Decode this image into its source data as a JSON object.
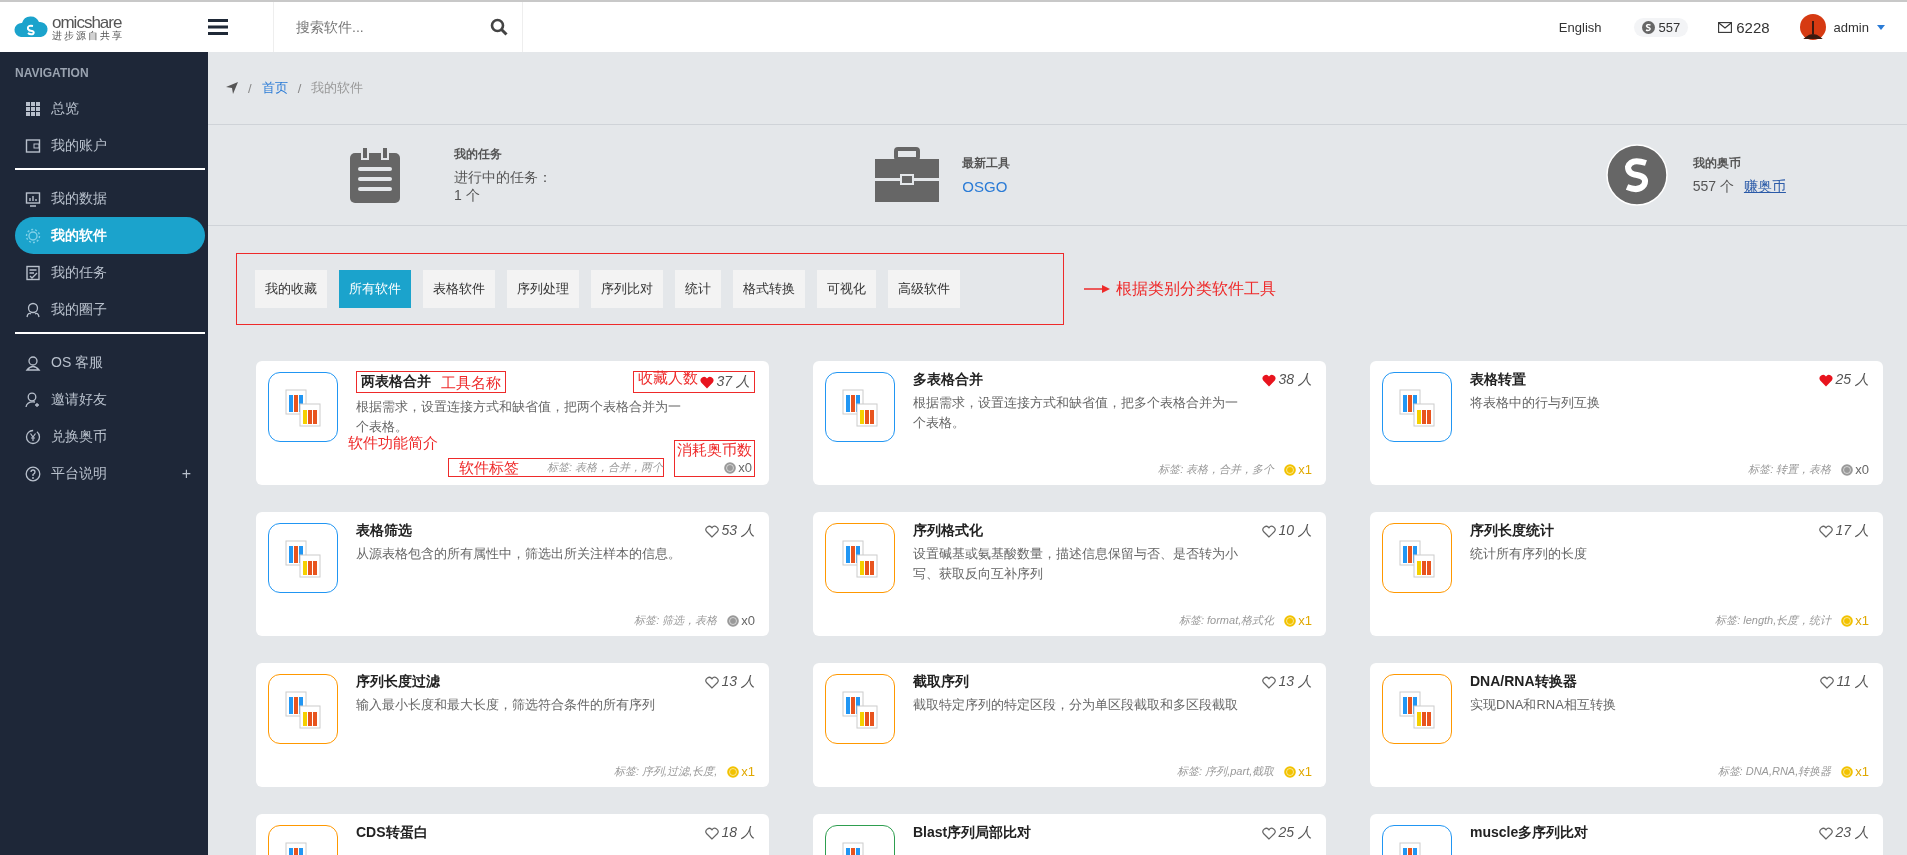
{
  "topbar": {
    "brand": {
      "name": "omicshare",
      "tagline": "进步源自共享"
    },
    "search": {
      "placeholder": "搜索软件..."
    },
    "language": "English",
    "coins": "557",
    "messages": "6228",
    "user": "admin"
  },
  "sidebar": {
    "heading": "NAVIGATION",
    "groups": [
      [
        {
          "label": "总览",
          "selected": false
        },
        {
          "label": "我的账户",
          "selected": false
        }
      ],
      [
        {
          "label": "我的数据",
          "selected": false
        },
        {
          "label": "我的软件",
          "selected": true
        },
        {
          "label": "我的任务",
          "selected": false
        },
        {
          "label": "我的圈子",
          "selected": false
        }
      ],
      [
        {
          "label": "OS 客服",
          "selected": false
        },
        {
          "label": "邀请好友",
          "selected": false
        },
        {
          "label": "兑换奥币",
          "selected": false
        },
        {
          "label": "平台说明",
          "selected": false,
          "expander": "+"
        }
      ]
    ]
  },
  "breadcrumb": {
    "separator": "/",
    "home": "首页",
    "current": "我的软件"
  },
  "stats": [
    {
      "title": "我的任务",
      "lines": [
        "进行中的任务：1 个"
      ]
    },
    {
      "title": "最新工具",
      "link": "OSGO"
    },
    {
      "title": "我的奥币",
      "lines": [
        "557 个"
      ],
      "link": "赚奥币"
    }
  ],
  "tabs": {
    "note": "根据类别分类软件工具",
    "items": [
      {
        "label": "我的收藏",
        "selected": false
      },
      {
        "label": "所有软件",
        "selected": true
      },
      {
        "label": "表格软件",
        "selected": false
      },
      {
        "label": "序列处理",
        "selected": false
      },
      {
        "label": "序列比对",
        "selected": false
      },
      {
        "label": "统计",
        "selected": false
      },
      {
        "label": "格式转换",
        "selected": false
      },
      {
        "label": "可视化",
        "selected": false
      },
      {
        "label": "高级软件",
        "selected": false
      }
    ]
  },
  "tools": [
    {
      "title": "两表格合并",
      "favorited": true,
      "favorites": "37 人",
      "description": "根据需求，设置连接方式和缺省值，把两个表格合并为一个表格。",
      "tags": "标签: 表格，合并，两个",
      "cost": "x0",
      "free": true,
      "color": "#2196f3",
      "notes": {
        "title": "工具名称",
        "favorites": "收藏人数",
        "description": "软件功能简介",
        "tags": "软件标签",
        "cost": "消耗奥币数"
      }
    },
    {
      "title": "多表格合并",
      "favorited": true,
      "favorites": "38 人",
      "description": "根据需求，设置连接方式和缺省值，把多个表格合并为一个表格。",
      "tags": "标签: 表格，合并，多个",
      "cost": "x1",
      "free": false,
      "color": "#2196f3"
    },
    {
      "title": "表格转置",
      "favorited": true,
      "favorites": "25 人",
      "description": "将表格中的行与列互换",
      "tags": "标签: 转置，表格",
      "cost": "x0",
      "free": true,
      "color": "#2196f3"
    },
    {
      "title": "表格筛选",
      "favorited": false,
      "favorites": "53 人",
      "description": "从源表格包含的所有属性中，筛选出所关注样本的信息。",
      "tags": "标签: 筛选，表格",
      "cost": "x0",
      "free": true,
      "color": "#2196f3"
    },
    {
      "title": "序列格式化",
      "favorited": false,
      "favorites": "10 人",
      "description": "设置碱基或氨基酸数量，描述信息保留与否、是否转为小写、获取反向互补序列",
      "tags": "标签: format,格式化",
      "cost": "x1",
      "free": false,
      "color": "#ff9800"
    },
    {
      "title": "序列长度统计",
      "favorited": false,
      "favorites": "17 人",
      "description": "统计所有序列的长度",
      "tags": "标签: length,长度，统计",
      "cost": "x1",
      "free": false,
      "color": "#ff9800"
    },
    {
      "title": "序列长度过滤",
      "favorited": false,
      "favorites": "13 人",
      "description": "输入最小长度和最大长度，筛选符合条件的所有序列",
      "tags": "标签: 序列,过滤,长度,",
      "cost": "x1",
      "free": false,
      "color": "#ff9800"
    },
    {
      "title": "截取序列",
      "favorited": false,
      "favorites": "13 人",
      "description": "截取特定序列的特定区段，分为单区段截取和多区段截取",
      "tags": "标签: 序列,part,截取",
      "cost": "x1",
      "free": false,
      "color": "#ff9800"
    },
    {
      "title": "DNA/RNA转换器",
      "favorited": false,
      "favorites": "11 人",
      "description": "实现DNA和RNA相互转换",
      "tags": "标签: DNA,RNA,转换器",
      "cost": "x1",
      "free": false,
      "color": "#ff9800"
    },
    {
      "title": "CDS转蛋白",
      "favorited": false,
      "favorites": "18 人",
      "color": "#ff9800"
    },
    {
      "title": "Blast序列局部比对",
      "favorited": false,
      "favorites": "25 人",
      "color": "#2e9e4f"
    },
    {
      "title": "muscle多序列比对",
      "favorited": false,
      "favorites": "23 人",
      "color": "#2196f3"
    }
  ]
}
